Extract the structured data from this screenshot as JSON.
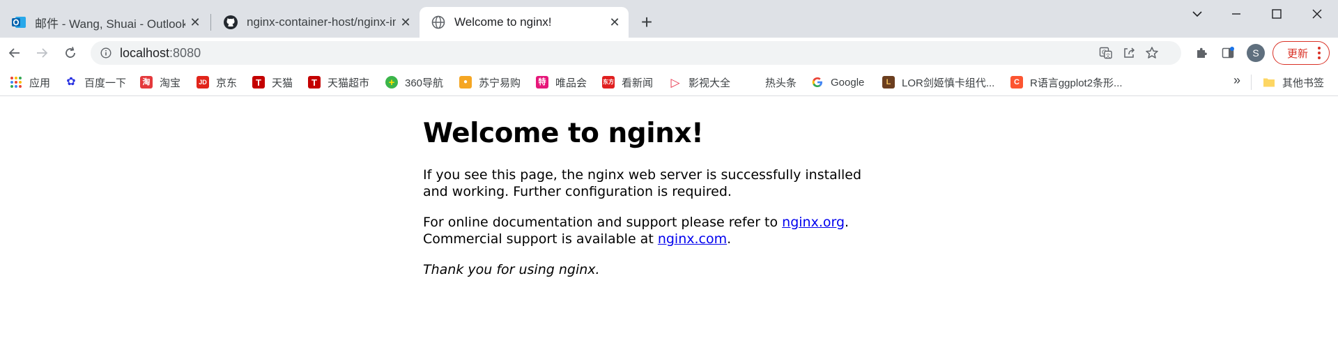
{
  "browser": {
    "tabs": [
      {
        "title": "邮件 - Wang, Shuai - Outlook",
        "icon": "outlook-icon",
        "active": false
      },
      {
        "title": "nginx-container-host/nginx-in",
        "icon": "github-icon",
        "active": false
      },
      {
        "title": "Welcome to nginx!",
        "icon": "globe-icon",
        "active": true
      }
    ],
    "address": {
      "host": "localhost",
      "port": ":8080"
    },
    "profile_initial": "S",
    "update_label": "更新"
  },
  "bookmarks": {
    "apps_label": "应用",
    "items": [
      {
        "label": "百度一下",
        "icon": "baidu-paw-icon",
        "color": "#2932e1",
        "glyph": "✿"
      },
      {
        "label": "淘宝",
        "icon": "taobao-icon",
        "color": "#e4393c",
        "glyph": "淘"
      },
      {
        "label": "京东",
        "icon": "jd-icon",
        "color": "#e1251b",
        "glyph": "JD"
      },
      {
        "label": "天猫",
        "icon": "tmall-icon",
        "color": "#c40000",
        "glyph": "T"
      },
      {
        "label": "天猫超市",
        "icon": "tmall-market-icon",
        "color": "#c40000",
        "glyph": "T"
      },
      {
        "label": "360导航",
        "icon": "360-icon",
        "color": "#3bb54a",
        "glyph": "+"
      },
      {
        "label": "苏宁易购",
        "icon": "suning-icon",
        "color": "#f5a623",
        "glyph": "●"
      },
      {
        "label": "唯品会",
        "icon": "vip-icon",
        "color": "#e6177a",
        "glyph": "特"
      },
      {
        "label": "看新闻",
        "icon": "news-icon",
        "color": "#e02020",
        "glyph": "东方"
      },
      {
        "label": "影视大全",
        "icon": "video-play-icon",
        "color": "#e8384f",
        "glyph": "▷"
      },
      {
        "label": "热头条",
        "icon": "",
        "color": "",
        "glyph": ""
      },
      {
        "label": "Google",
        "icon": "google-icon",
        "color": "#4285f4",
        "glyph": "G"
      },
      {
        "label": "LOR剑姬慎卡组代...",
        "icon": "lor-icon",
        "color": "#6b3e1f",
        "glyph": "L"
      },
      {
        "label": "R语言ggplot2条形...",
        "icon": "csdn-icon",
        "color": "#fc5531",
        "glyph": "C"
      }
    ],
    "more_label": "»",
    "other_label": "其他书签"
  },
  "page": {
    "heading": "Welcome to nginx!",
    "p1": "If you see this page, the nginx web server is successfully installed and working. Further configuration is required.",
    "p2_prefix": "For online documentation and support please refer to ",
    "link1": "nginx.org",
    "p2_mid": ".",
    "p2_line2_prefix": "Commercial support is available at ",
    "link2": "nginx.com",
    "p2_end": ".",
    "thanks": "Thank you for using nginx."
  }
}
